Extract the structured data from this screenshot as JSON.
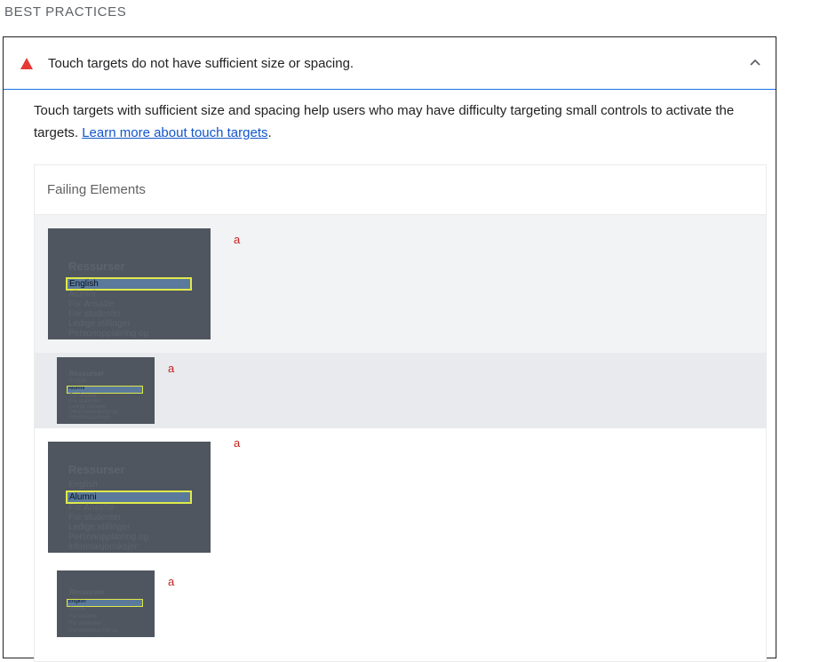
{
  "section": {
    "title": "BEST PRACTICES"
  },
  "audit": {
    "title": "Touch targets do not have sufficient size or spacing.",
    "description": "Touch targets with sufficient size and spacing help users who may have difficulty targeting small controls to activate the targets.",
    "learn_more": "Learn more about touch targets",
    "period": ".",
    "status_color": "#e53935",
    "accent": "#1a73e8"
  },
  "table": {
    "header": "Failing Elements",
    "rows": [
      {
        "label": "a",
        "thumb": {
          "title": "Ressurser",
          "highlight": "English",
          "lines": [
            "Alumni",
            "For Ansatte",
            "For studenter",
            "Ledige stillinger",
            "Personopplæring og"
          ]
        }
      },
      {
        "label": "a",
        "thumb": {
          "title": "Ressurser",
          "highlight": "Alumni",
          "lines": [
            "English",
            "For Ansatte",
            "For studenter",
            "Ledige stillinger",
            "Personopplæring og",
            "informasjonsksjer"
          ]
        }
      },
      {
        "label": "a",
        "thumb": {
          "title": "Ressurser",
          "highlight": "Alumni",
          "lines": [
            "English",
            "For Ansatte",
            "For studenter",
            "Ledige stillinger",
            "Personopplæring og",
            "informasjonsksjer"
          ]
        }
      },
      {
        "label": "a",
        "thumb": {
          "title": "Ressurser",
          "highlight": "English",
          "lines": [
            "Alumni",
            "For Ansatte",
            "For studenter",
            "Personopplæring og"
          ]
        }
      }
    ]
  }
}
